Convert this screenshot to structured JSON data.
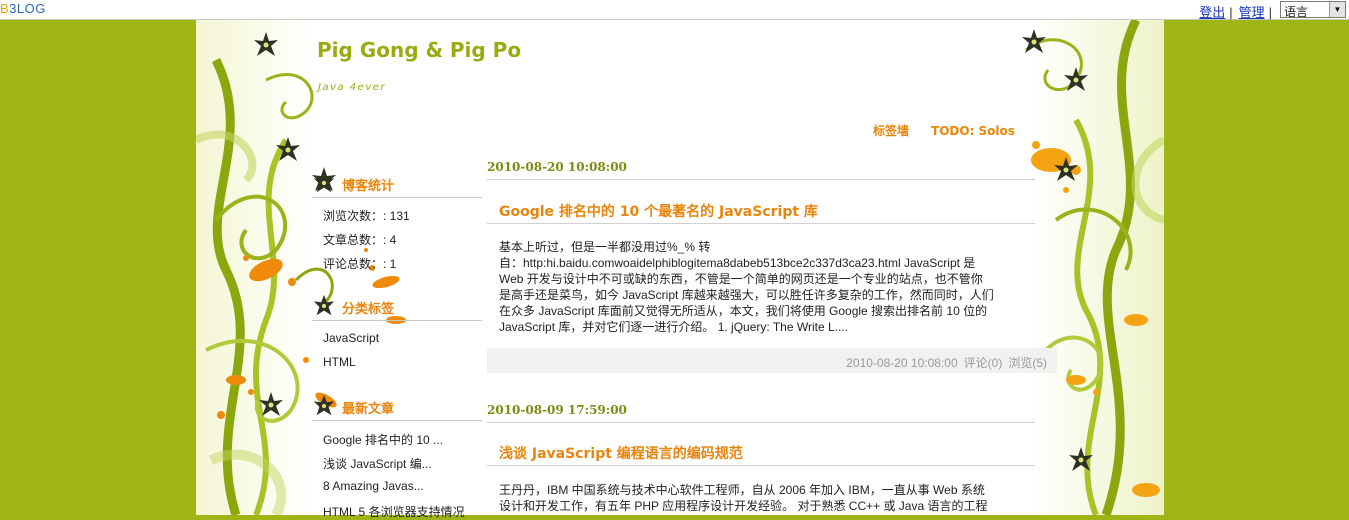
{
  "topbar": {
    "logo_b": "B",
    "logo_rest": "3LOG",
    "logout": "登出",
    "separator": "|",
    "admin": "管理",
    "language_selected": "语言"
  },
  "header": {
    "title": "Pig Gong & Pig Po",
    "subtitle": "Java 4ever",
    "nav": [
      "标签墙",
      "TODO: Solos"
    ]
  },
  "sidebar": {
    "stats": {
      "title": "博客统计",
      "items": [
        "浏览次数：: 131",
        "文章总数：: 4",
        "评论总数：: 1"
      ]
    },
    "categories": {
      "title": "分类标签",
      "items": [
        "JavaScript",
        "HTML"
      ]
    },
    "recent": {
      "title": "最新文章",
      "items": [
        "Google 排名中的 10 ...",
        "浅谈 JavaScript 编...",
        "8 Amazing Javas...",
        "HTML 5 各浏览器支持情况"
      ]
    }
  },
  "posts": [
    {
      "date": "2010-08-20 10:08:00",
      "title": "Google 排名中的 10 个最著名的 JavaScript 库",
      "body_lines": [
        "基本上听过，但是一半都没用过%_% 转",
        "自：http:hi.baidu.comwoaidelphiblogitema8dabeb513bce2c337d3ca23.html JavaScript 是",
        "Web 开发与设计中不可或缺的东西，不管是一个简单的网页还是一个专业的站点，也不管你",
        "是高手还是菜鸟，如今 JavaScript 库越来越强大，可以胜任许多复杂的工作，然而同时，人们",
        "在众多 JavaScript 库面前又觉得无所适从，本文，我们将使用 Google 搜索出排名前 10 位的",
        "JavaScript 库，并对它们逐一进行介绍。 1. jQuery: The Write L...."
      ],
      "meta_time": "2010-08-20 10:08:00",
      "meta_comments": "评论(0)",
      "meta_views": "浏览(5)"
    },
    {
      "date": "2010-08-09 17:59:00",
      "title": "浅谈 JavaScript 编程语言的编码规范",
      "body_lines": [
        "王丹丹，IBM 中国系统与技术中心软件工程师，自从 2006 年加入 IBM，一直从事 Web 系统",
        "设计和开发工作，有五年 PHP 应用程序设计开发经验。 对于熟悉 CC++ 或 Java 语言的工程"
      ]
    }
  ],
  "colors": {
    "background": "#9fb515",
    "accent_orange": "#e9850c",
    "title_green": "#98ac12",
    "date_green": "#7d8a10"
  },
  "icons": [
    "flower-star-icon",
    "chevron-down-icon"
  ]
}
